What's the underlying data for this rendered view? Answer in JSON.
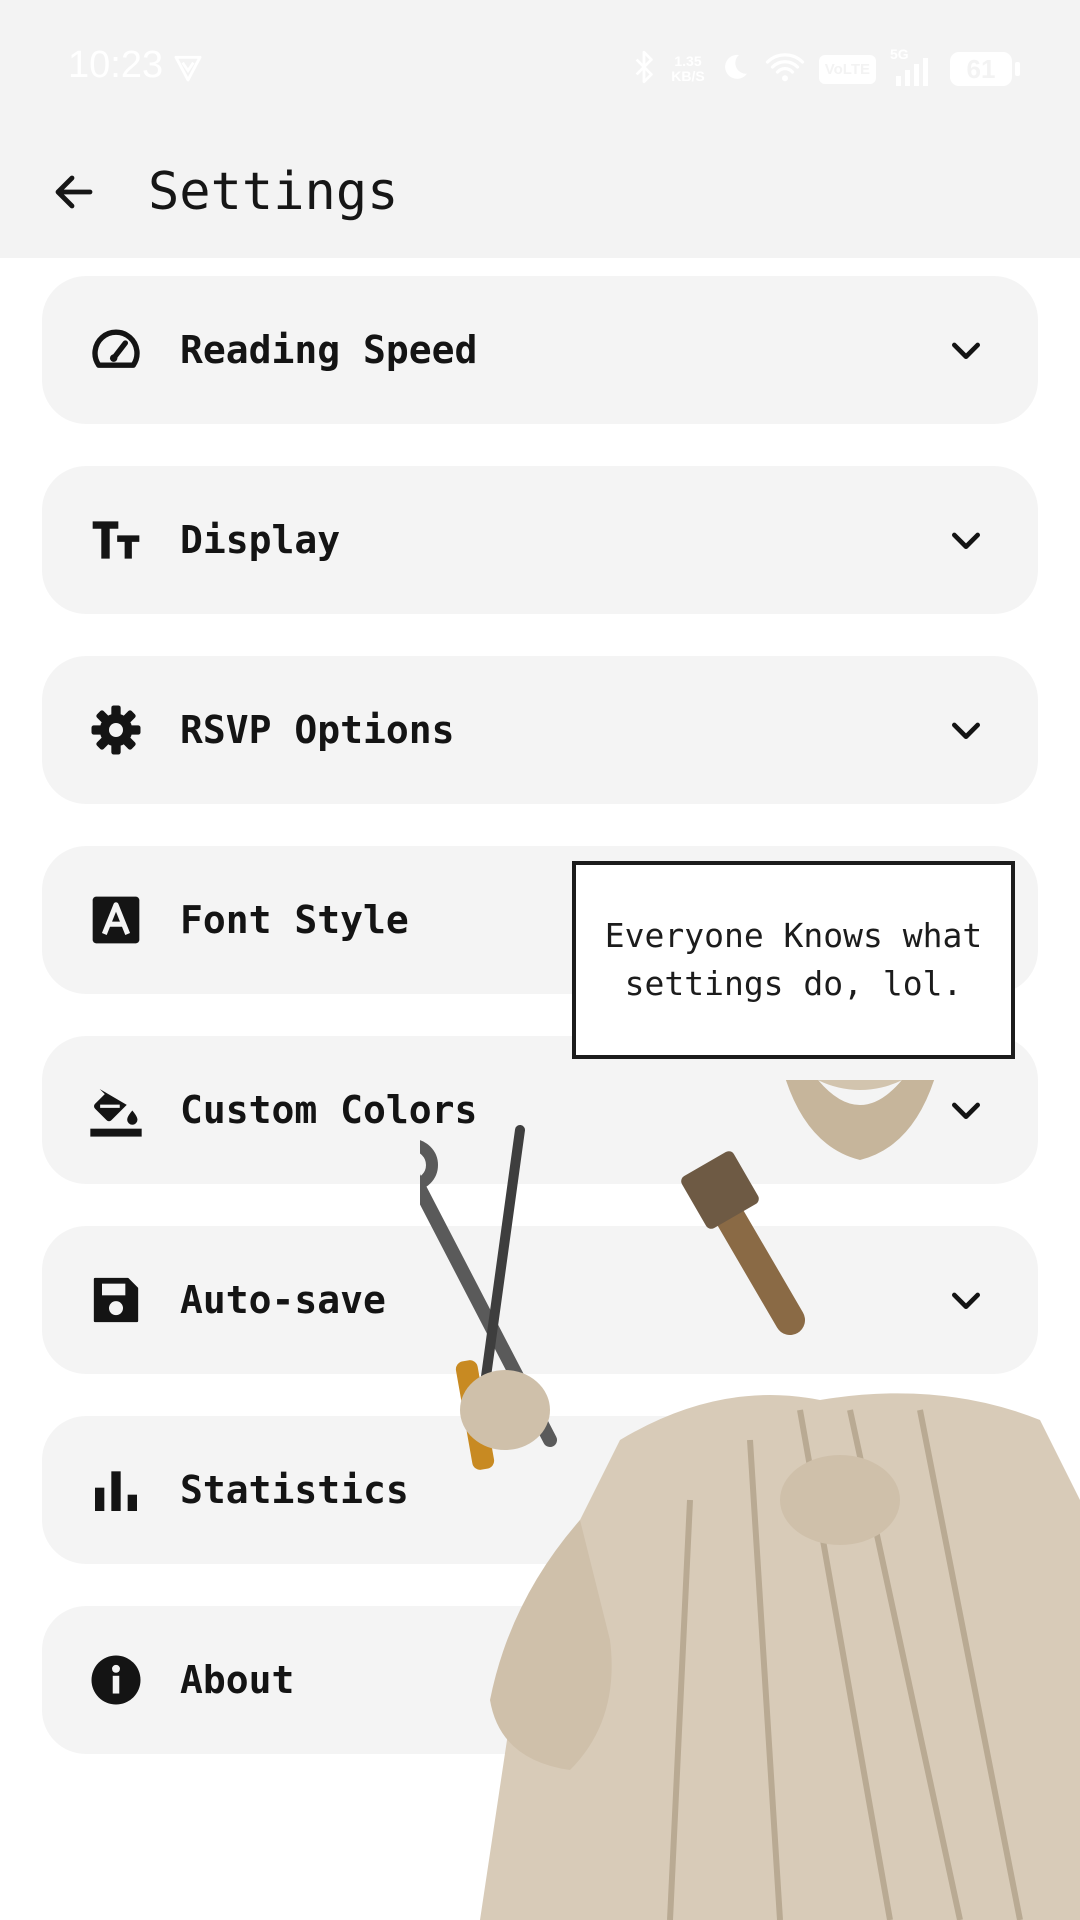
{
  "status_bar": {
    "time": "10:23",
    "net_speed_value": "1.35",
    "net_speed_unit": "KB/S",
    "volte": "VoLTE",
    "network": "5G",
    "battery": "61"
  },
  "app_bar": {
    "title": "Settings"
  },
  "settings": [
    {
      "label": "Reading Speed",
      "icon": "speedometer-icon"
    },
    {
      "label": "Display",
      "icon": "text-size-icon"
    },
    {
      "label": "RSVP Options",
      "icon": "gear-icon"
    },
    {
      "label": "Font Style",
      "icon": "font-icon"
    },
    {
      "label": "Custom Colors",
      "icon": "paint-bucket-icon"
    },
    {
      "label": "Auto-save",
      "icon": "save-icon"
    },
    {
      "label": "Statistics",
      "icon": "bar-chart-icon"
    },
    {
      "label": "About",
      "icon": "info-icon"
    }
  ],
  "overlay": {
    "caption_line1": "Everyone Knows what",
    "caption_line2": "settings do, lol."
  },
  "colors": {
    "bar_background": "#f3f3f3",
    "card_background": "#f4f4f4",
    "text": "#141414"
  }
}
